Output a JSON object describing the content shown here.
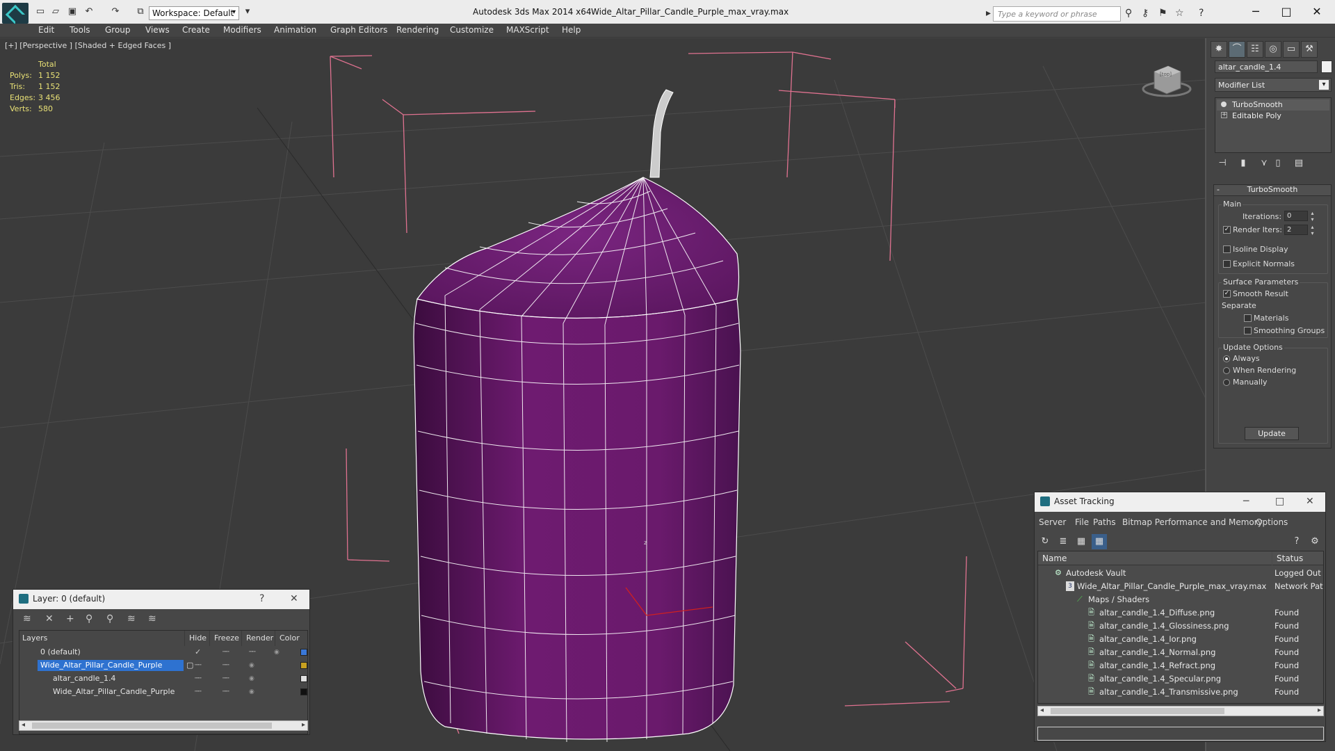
{
  "titlebar": {
    "workspace": "Workspace: Default",
    "app": "Autodesk 3ds Max  2014 x64",
    "file": "Wide_Altar_Pillar_Candle_Purple_max_vray.max",
    "search_placeholder": "Type a keyword or phrase",
    "minimize": "─",
    "maximize": "□",
    "close": "✕"
  },
  "menu": [
    "Edit",
    "Tools",
    "Group",
    "Views",
    "Create",
    "Modifiers",
    "Animation",
    "Graph Editors",
    "Rendering",
    "Customize",
    "MAXScript",
    "Help"
  ],
  "viewport": {
    "label": "[+] [Perspective ] [Shaded + Edged Faces ]",
    "stats": {
      "header": "Total",
      "rows": [
        {
          "label": "Polys:",
          "value": "1 152"
        },
        {
          "label": "Tris:",
          "value": "1 152"
        },
        {
          "label": "Edges:",
          "value": "3 456"
        },
        {
          "label": "Verts:",
          "value": "580"
        }
      ]
    },
    "viewcube_label": "[top]",
    "axis_z": "z",
    "colors": {
      "candle": "#6a1a6c",
      "wire": "#ffffff",
      "bbox": "#e06f8a",
      "grid": "#4a4a4a"
    }
  },
  "command_panel": {
    "object_name": "altar_candle_1.4",
    "modifier_list": "Modifier List",
    "stack": [
      "TurboSmooth",
      "Editable Poly"
    ],
    "rollout": {
      "title": "TurboSmooth",
      "main": "Main",
      "iterations_label": "Iterations:",
      "iterations": "0",
      "render_iters_label": "Render Iters:",
      "render_iters": "2",
      "isoline": "Isoline Display",
      "explicit": "Explicit Normals",
      "surface_params": "Surface Parameters",
      "smooth_result": "Smooth Result",
      "separate": "Separate",
      "materials": "Materials",
      "smoothing_groups": "Smoothing Groups",
      "update_options": "Update Options",
      "always": "Always",
      "when_rendering": "When Rendering",
      "manually": "Manually",
      "update": "Update"
    }
  },
  "layers": {
    "title": "Layer: 0 (default)",
    "help": "?",
    "close": "✕",
    "headers": [
      "Layers",
      "Hide",
      "Freeze",
      "Render",
      "Color"
    ],
    "rows": [
      {
        "name": "0 (default)",
        "color": "#3a78d8"
      },
      {
        "name": "Wide_Altar_Pillar_Candle_Purple",
        "color": "#c8a020"
      },
      {
        "name": "altar_candle_1.4",
        "color": "#e0e0e0"
      },
      {
        "name": "Wide_Altar_Pillar_Candle_Purple",
        "color": "#111111"
      }
    ]
  },
  "asset_tracking": {
    "title": "Asset Tracking",
    "menu": [
      "Server",
      "File",
      "Paths",
      "Bitmap Performance and Memory",
      "Options"
    ],
    "headers": [
      "Name",
      "Status"
    ],
    "rows": [
      {
        "name": "Autodesk Vault",
        "status": "Logged Out ..."
      },
      {
        "name": "Wide_Altar_Pillar_Candle_Purple_max_vray.max",
        "status": "Network Path"
      },
      {
        "name": "Maps / Shaders",
        "status": ""
      },
      {
        "name": "altar_candle_1.4_Diffuse.png",
        "status": "Found"
      },
      {
        "name": "altar_candle_1.4_Glossiness.png",
        "status": "Found"
      },
      {
        "name": "altar_candle_1.4_Ior.png",
        "status": "Found"
      },
      {
        "name": "altar_candle_1.4_Normal.png",
        "status": "Found"
      },
      {
        "name": "altar_candle_1.4_Refract.png",
        "status": "Found"
      },
      {
        "name": "altar_candle_1.4_Specular.png",
        "status": "Found"
      },
      {
        "name": "altar_candle_1.4_Transmissive.png",
        "status": "Found"
      }
    ]
  }
}
